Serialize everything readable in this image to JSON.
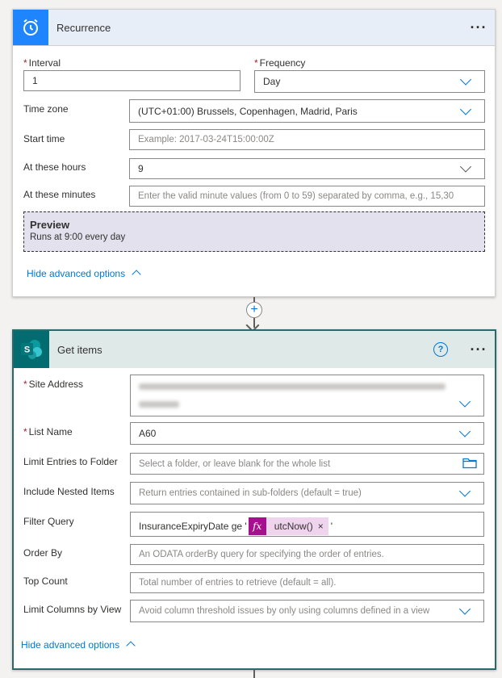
{
  "recurrence": {
    "title": "Recurrence",
    "menu": "···",
    "interval": {
      "label": "Interval",
      "value": "1"
    },
    "frequency": {
      "label": "Frequency",
      "value": "Day"
    },
    "time_zone": {
      "label": "Time zone",
      "value": "(UTC+01:00) Brussels, Copenhagen, Madrid, Paris"
    },
    "start_time": {
      "label": "Start time",
      "placeholder": "Example: 2017-03-24T15:00:00Z"
    },
    "at_hours": {
      "label": "At these hours",
      "value": "9"
    },
    "at_minutes": {
      "label": "At these minutes",
      "placeholder": "Enter the valid minute values (from 0 to 59) separated by comma, e.g., 15,30"
    },
    "preview": {
      "title": "Preview",
      "text": "Runs at 9:00 every day"
    },
    "hide_advanced": "Hide advanced options"
  },
  "connector": {
    "plus": "+"
  },
  "get_items": {
    "title": "Get items",
    "icon_letter": "S",
    "help": "?",
    "menu": "···",
    "site_address": {
      "label": "Site Address"
    },
    "list_name": {
      "label": "List Name",
      "value": "A60"
    },
    "limit_folder": {
      "label": "Limit Entries to Folder",
      "placeholder": "Select a folder, or leave blank for the whole list"
    },
    "nested": {
      "label": "Include Nested Items",
      "placeholder": "Return entries contained in sub-folders (default = true)"
    },
    "filter": {
      "label": "Filter Query",
      "prefix": "InsuranceExpiryDate ge '",
      "fx": "fx",
      "token": "utcNow()",
      "token_close": "×",
      "suffix": "'"
    },
    "order_by": {
      "label": "Order By",
      "placeholder": "An ODATA orderBy query for specifying the order of entries."
    },
    "top_count": {
      "label": "Top Count",
      "placeholder": "Total number of entries to retrieve (default = all)."
    },
    "limit_view": {
      "label": "Limit Columns by View",
      "placeholder": "Avoid column threshold issues by only using columns defined in a view"
    },
    "hide_advanced": "Hide advanced options"
  },
  "required_marker": "*",
  "colors": {
    "accent": "#0078d4",
    "recurrence_icon_bg": "#1f85ff",
    "sharepoint_bg": "#036c70",
    "fx_bg": "#a5108e",
    "preview_bg": "#e3e1ee"
  }
}
